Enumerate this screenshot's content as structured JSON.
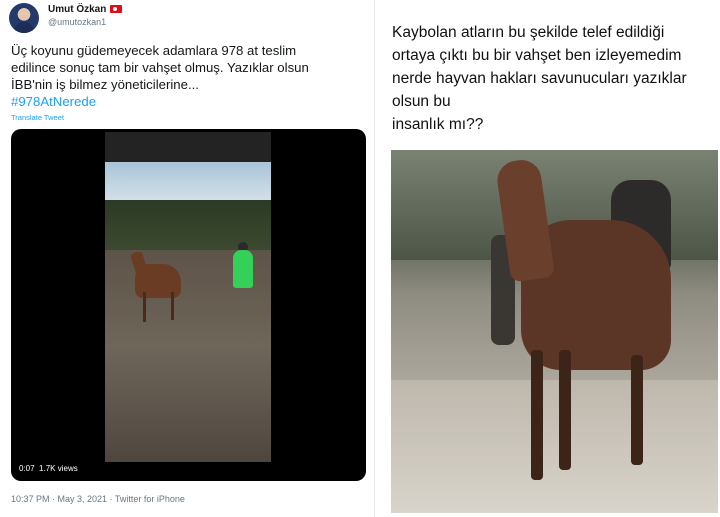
{
  "tweet": {
    "user_name": "Umut Özkan",
    "user_handle": "@umutozkan1",
    "text_line1": "Üç koyunu güdemeyecek adamlara 978 at teslim",
    "text_line2": "edilince sonuç tam bir vahşet olmuş. Yazıklar olsun",
    "text_line3": "İBB'nin iş bilmez yöneticilerine...",
    "hashtag": "#978AtNerede",
    "translate_label": "Translate Tweet",
    "video": {
      "time": "0:07",
      "views": "1.7K views"
    },
    "meta": "10:37 PM · May 3, 2021 · Twitter for iPhone"
  },
  "post": {
    "caption_lines": [
      "Kaybolan atların bu şekilde telef edildiği",
      "ortaya çıktı bu bir vahşet ben izleyemedim",
      "nerde hayvan hakları savunucuları yazıklar",
      "olsun bu",
      "insanlık mı??"
    ]
  },
  "colors": {
    "link": "#1da1f2",
    "text": "#14171a",
    "muted": "#657786"
  }
}
